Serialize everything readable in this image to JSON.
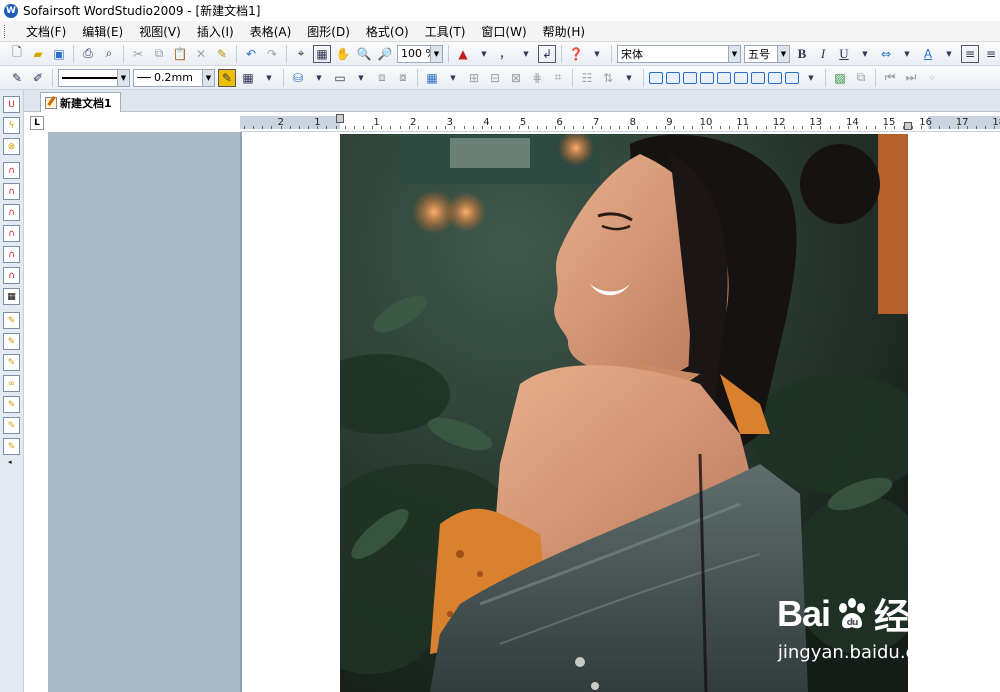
{
  "window": {
    "title": "Sofairsoft WordStudio2009 - [新建文档1]"
  },
  "menu": [
    "文档(F)",
    "编辑(E)",
    "视图(V)",
    "插入(I)",
    "表格(A)",
    "图形(D)",
    "格式(O)",
    "工具(T)",
    "窗口(W)",
    "帮助(H)"
  ],
  "toolbar1": {
    "zoom_value": "100 %",
    "punct_combo": "，",
    "font_name": "宋体",
    "font_size": "五号",
    "bold_label": "B",
    "italic_label": "I",
    "underline_label": "U"
  },
  "toolbar2": {
    "line_width_value": "0.2mm"
  },
  "document_tabs": [
    {
      "label": "新建文档1",
      "active": true
    }
  ],
  "ruler": {
    "corner_label": "L",
    "numbers": [
      "2",
      "1",
      "1",
      "2",
      "3",
      "4",
      "5",
      "6",
      "7",
      "8",
      "9",
      "10",
      "11",
      "12",
      "13",
      "14",
      "15",
      "16",
      "17",
      "18"
    ]
  },
  "watermark": {
    "brand_latin": "Bai",
    "brand_chinese": "经验",
    "url": "jingyan.baidu.com"
  },
  "colors": {
    "accent": "#2a6fc9",
    "gray_region": "#a9b9c8",
    "menu_bg": "#f4f4f4"
  },
  "icons": {
    "app": "wordstudio-logo-icon",
    "new": "new-document-icon",
    "open": "open-folder-icon",
    "save": "save-icon",
    "print": "print-icon",
    "help": "help-icon"
  }
}
